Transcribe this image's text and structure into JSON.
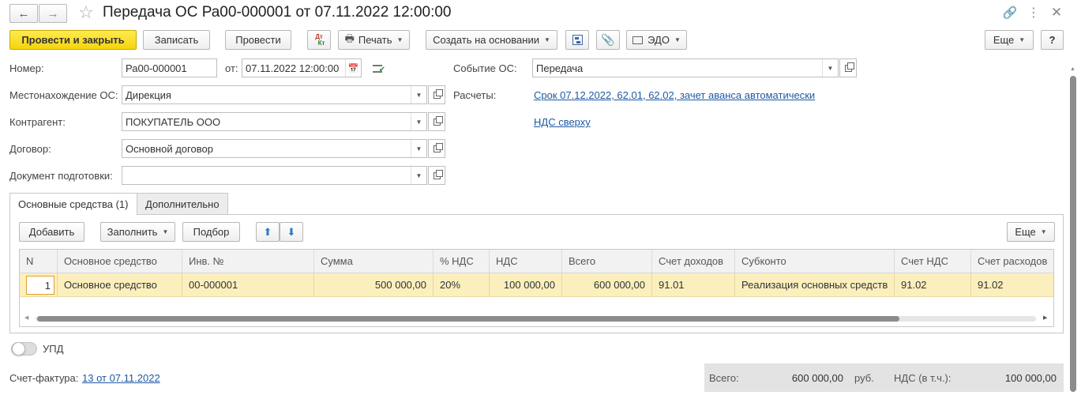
{
  "window": {
    "title": "Передача ОС Ра00-000001 от 07.11.2022 12:00:00"
  },
  "toolbar": {
    "post_close": "Провести и закрыть",
    "save": "Записать",
    "post": "Провести",
    "dt_kt": "Дт",
    "kt": "Кт",
    "print": "Печать",
    "create_based": "Создать на основании",
    "edo": "ЭДО",
    "more": "Еще",
    "help": "?"
  },
  "form": {
    "number_label": "Номер:",
    "number_value": "Ра00-000001",
    "date_label": "от:",
    "date_value": "07.11.2022 12:00:00",
    "location_label": "Местонахождение ОС:",
    "location_value": "Дирекция",
    "counterparty_label": "Контрагент:",
    "counterparty_value": "ПОКУПАТЕЛЬ ООО",
    "contract_label": "Договор:",
    "contract_value": "Основной договор",
    "prep_doc_label": "Документ подготовки:",
    "prep_doc_value": "",
    "event_label": "Событие ОС:",
    "event_value": "Передача",
    "settlements_label": "Расчеты:",
    "settlements_link": "Срок 07.12.2022, 62.01, 62.02, зачет аванса автоматически",
    "vat_link": "НДС сверху"
  },
  "tabs": [
    {
      "label": "Основные средства (1)",
      "active": true
    },
    {
      "label": "Дополнительно",
      "active": false
    }
  ],
  "table_toolbar": {
    "add": "Добавить",
    "fill": "Заполнить",
    "pick": "Подбор",
    "more": "Еще"
  },
  "table": {
    "columns": [
      "N",
      "Основное средство",
      "Инв. №",
      "Сумма",
      "% НДС",
      "НДС",
      "Всего",
      "Счет доходов",
      "Субконто",
      "Счет НДС",
      "Счет расходов"
    ],
    "rows": [
      [
        "1",
        "Основное средство",
        "00-000001",
        "500 000,00",
        "20%",
        "100 000,00",
        "600 000,00",
        "91.01",
        "Реализация основных средств",
        "91.02",
        "91.02"
      ]
    ]
  },
  "upd": {
    "label": "УПД",
    "enabled": false
  },
  "footer": {
    "invoice_label": "Счет-фактура:",
    "invoice_link": "13 от 07.11.2022",
    "total_label": "Всего:",
    "total_value": "600 000,00",
    "currency": "руб.",
    "vat_label": "НДС (в т.ч.):",
    "vat_value": "100 000,00"
  },
  "colors": {
    "primary_button": "#f5d40f",
    "selected_row": "#fbefbd",
    "link": "#1d5aa3",
    "footer_bg": "#e3e3e3"
  }
}
